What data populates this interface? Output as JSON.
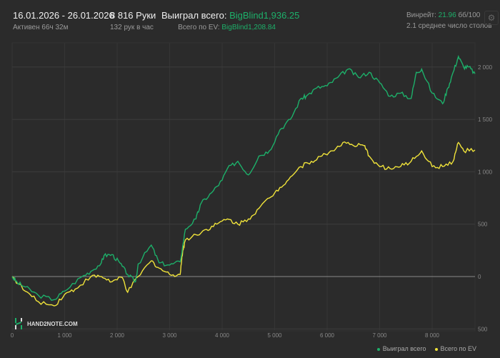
{
  "header": {
    "date_range": "16.01.2026 - 26.01.2026",
    "active": "Активен 66ч 32м",
    "hands": "8 816 Руки",
    "hands_per_hour": "132 рук в час",
    "won_label": "Выиграл всего:",
    "won_value": "BigBlind1,936.25",
    "ev_label": "Всего по EV:",
    "ev_value": "BigBlind1,208.84",
    "winrate_label": "Винрейт:",
    "winrate_value": "21.96",
    "winrate_unit": "бб/100",
    "tables": "2.1 среднее число столов"
  },
  "logo": {
    "text": "HAND2NOTE.COM"
  },
  "colors": {
    "won": "#1db06a",
    "ev": "#f0e33a",
    "grid": "#3a3a3a"
  },
  "chart_data": {
    "type": "line",
    "xlabel": "",
    "ylabel": "",
    "xlim": [
      0,
      8816
    ],
    "ylim": [
      -500,
      2200
    ],
    "x_ticks": [
      0,
      1000,
      2000,
      3000,
      4000,
      5000,
      6000,
      7000,
      8000
    ],
    "x_tick_labels": [
      "0",
      "1 000",
      "2 000",
      "3 000",
      "4 000",
      "5 000",
      "6 000",
      "7 000",
      "8 000"
    ],
    "y_ticks": [
      2000,
      1500,
      1000,
      500,
      0,
      -500
    ],
    "y_tick_labels": [
      "2 000",
      "1 500",
      "1 000",
      "500",
      "0",
      "500"
    ],
    "legend": [
      "Выиграл всего",
      "Всего по EV"
    ],
    "legend_position": "bottom-right",
    "series": [
      {
        "name": "Выиграл всего",
        "x": [
          0,
          100,
          250,
          500,
          800,
          1000,
          1300,
          1500,
          1700,
          1750,
          1900,
          2050,
          2200,
          2350,
          2400,
          2650,
          2800,
          3000,
          3200,
          3300,
          3500,
          3600,
          3800,
          4000,
          4100,
          4300,
          4500,
          4700,
          4900,
          5100,
          5300,
          5500,
          5600,
          5800,
          6000,
          6200,
          6400,
          6600,
          6800,
          7000,
          7200,
          7400,
          7600,
          7700,
          7800,
          8000,
          8200,
          8300,
          8400,
          8500,
          8600,
          8700,
          8816
        ],
        "y": [
          0,
          -60,
          -100,
          -180,
          -220,
          -140,
          -10,
          50,
          130,
          200,
          210,
          130,
          20,
          -50,
          120,
          300,
          130,
          110,
          140,
          450,
          550,
          700,
          800,
          920,
          1030,
          1100,
          970,
          1150,
          1200,
          1400,
          1500,
          1700,
          1720,
          1800,
          1820,
          1900,
          1980,
          1900,
          1950,
          1850,
          1720,
          1750,
          1700,
          1950,
          1980,
          1750,
          1650,
          1800,
          1950,
          2100,
          2000,
          2000,
          1936
        ]
      },
      {
        "name": "Всего по EV",
        "x": [
          0,
          250,
          500,
          800,
          1000,
          1200,
          1500,
          1700,
          1900,
          2100,
          2200,
          2400,
          2650,
          2800,
          3000,
          3200,
          3250,
          3300,
          3500,
          3700,
          3900,
          4100,
          4300,
          4500,
          4700,
          4900,
          5100,
          5300,
          5500,
          5700,
          5900,
          6100,
          6300,
          6500,
          6700,
          6800,
          7000,
          7200,
          7400,
          7600,
          7800,
          8000,
          8200,
          8400,
          8500,
          8600,
          8816
        ],
        "y": [
          0,
          -140,
          -240,
          -280,
          -170,
          -120,
          0,
          0,
          -50,
          -10,
          -150,
          0,
          150,
          80,
          20,
          20,
          250,
          350,
          400,
          450,
          500,
          550,
          500,
          550,
          650,
          750,
          850,
          950,
          1050,
          1100,
          1150,
          1200,
          1280,
          1250,
          1250,
          1150,
          1050,
          1030,
          1050,
          1100,
          1200,
          1050,
          1050,
          1100,
          1280,
          1200,
          1208
        ]
      }
    ]
  }
}
